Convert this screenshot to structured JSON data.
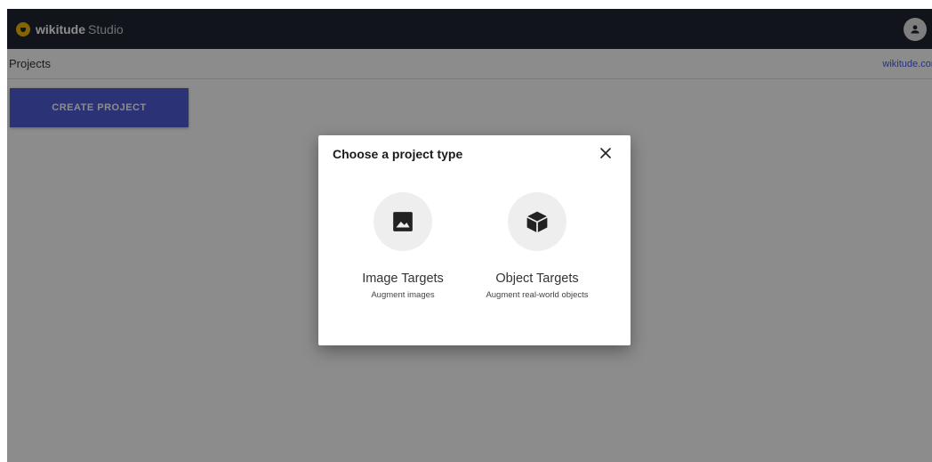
{
  "header": {
    "brand_name": "wikitude",
    "brand_suffix": "Studio",
    "brand_color": "#f2b705",
    "account_icon": "account-circle-icon"
  },
  "subheader": {
    "title": "Projects",
    "link": "wikitude.com"
  },
  "actions": {
    "create_project": "CREATE PROJECT",
    "accent": "#4f5bd5"
  },
  "modal": {
    "title": "Choose a project type",
    "close_icon": "close-icon",
    "options": [
      {
        "icon": "image-icon",
        "title": "Image Targets",
        "subtitle": "Augment images"
      },
      {
        "icon": "cube-icon",
        "title": "Object Targets",
        "subtitle": "Augment real-world objects"
      }
    ]
  }
}
